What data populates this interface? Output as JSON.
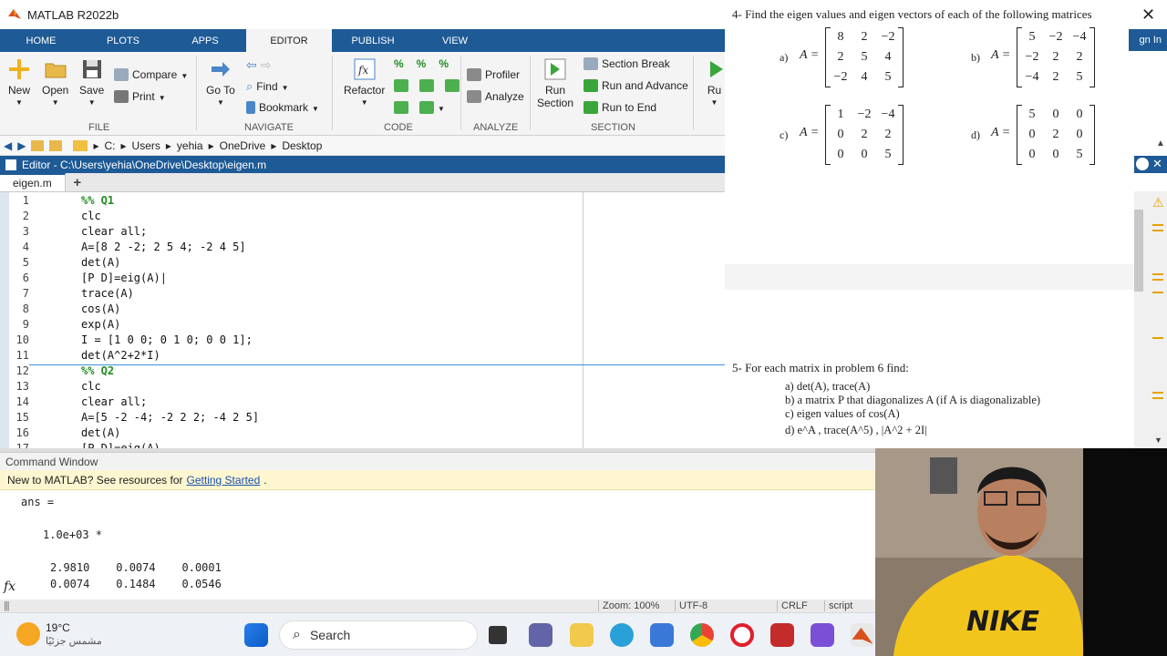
{
  "app": {
    "title": "MATLAB R2022b"
  },
  "ribbon": {
    "tabs": [
      "HOME",
      "PLOTS",
      "APPS",
      "EDITOR",
      "PUBLISH",
      "VIEW"
    ],
    "groups": [
      "FILE",
      "NAVIGATE",
      "CODE",
      "ANALYZE",
      "SECTION"
    ],
    "file": {
      "new": "New",
      "open": "Open",
      "save": "Save",
      "compare": "Compare",
      "print": "Print"
    },
    "navigate": {
      "goto": "Go To",
      "find": "Find",
      "bookmark": "Bookmark"
    },
    "code": {
      "refactor": "Refactor"
    },
    "analyze": {
      "profiler": "Profiler",
      "analyze": "Analyze"
    },
    "section": {
      "run_section_1": "Run",
      "run_section_2": "Section",
      "section_break": "Section Break",
      "run_advance": "Run and Advance",
      "run_to_end": "Run to End"
    },
    "run": {
      "run": "Ru"
    }
  },
  "path": [
    "C:",
    "Users",
    "yehia",
    "OneDrive",
    "Desktop"
  ],
  "editor": {
    "title": "Editor - C:\\Users\\yehia\\OneDrive\\Desktop\\eigen.m",
    "tab": "eigen.m",
    "lines": [
      {
        "n": "1",
        "code": "%% Q1",
        "section": true
      },
      {
        "n": "2",
        "code": "clc"
      },
      {
        "n": "3",
        "code": "clear all;"
      },
      {
        "n": "4",
        "code": "A=[8 2 -2; 2 5 4; -2 4 5]"
      },
      {
        "n": "5",
        "code": "det(A)"
      },
      {
        "n": "6",
        "code": "[P D]=eig(A)|"
      },
      {
        "n": "7",
        "code": "trace(A)"
      },
      {
        "n": "8",
        "code": "cos(A)"
      },
      {
        "n": "9",
        "code": "exp(A)"
      },
      {
        "n": "10",
        "code": "I = [1 0 0; 0 1 0; 0 0 1];"
      },
      {
        "n": "11",
        "code": "det(A^2+2*I)"
      },
      {
        "n": "12",
        "code": "%% Q2",
        "section": true
      },
      {
        "n": "13",
        "code": "clc"
      },
      {
        "n": "14",
        "code": "clear all;"
      },
      {
        "n": "15",
        "code": "A=[5 -2 -4; -2 2 2; -4 2 5]"
      },
      {
        "n": "16",
        "code": "det(A)"
      },
      {
        "n": "17",
        "code": "[P D]=eig(A)"
      }
    ]
  },
  "doc": {
    "problem4": "4-  Find the eigen values and eigen vectors of each of the following matrices",
    "matrices": [
      {
        "label": "a)",
        "eq": "A =",
        "rows": [
          [
            "8",
            "2",
            "−2"
          ],
          [
            "2",
            "5",
            "4"
          ],
          [
            "−2",
            "4",
            "5"
          ]
        ]
      },
      {
        "label": "b)",
        "eq": "A =",
        "rows": [
          [
            "5",
            "−2",
            "−4"
          ],
          [
            "−2",
            "2",
            "2"
          ],
          [
            "−4",
            "2",
            "5"
          ]
        ]
      },
      {
        "label": "c)",
        "eq": "A =",
        "rows": [
          [
            "1",
            "−2",
            "−4"
          ],
          [
            "0",
            "2",
            "2"
          ],
          [
            "0",
            "0",
            "5"
          ]
        ]
      },
      {
        "label": "d)",
        "eq": "A =",
        "rows": [
          [
            "5",
            "0",
            "0"
          ],
          [
            "0",
            "2",
            "0"
          ],
          [
            "0",
            "0",
            "5"
          ]
        ]
      }
    ],
    "problem5": "5-   For each matrix in problem 6 find:",
    "items": [
      "a)   det(A), trace(A)",
      "b)   a matrix P that diagonalizes A (if A is diagonalizable)",
      "c)   eigen values of cos(A)",
      "d)   e^A , trace(A^5) , |A^2 + 2I|"
    ]
  },
  "misc": {
    "signin": "gn In"
  },
  "command": {
    "title": "Command Window",
    "banner_text": "New to MATLAB? See resources for",
    "banner_link": "Getting Started",
    "banner_end": ".",
    "lines": [
      "ans =",
      "1.0e+03 *",
      "2.9810    0.0074    0.0001",
      "0.0074    0.1484    0.0546"
    ]
  },
  "status": {
    "zoom": "Zoom: 100%",
    "encoding": "UTF-8",
    "eol": "CRLF",
    "type": "script"
  },
  "taskbar": {
    "temp": "19°C",
    "weather": "مشمس جزئيًا",
    "search": "Search"
  }
}
